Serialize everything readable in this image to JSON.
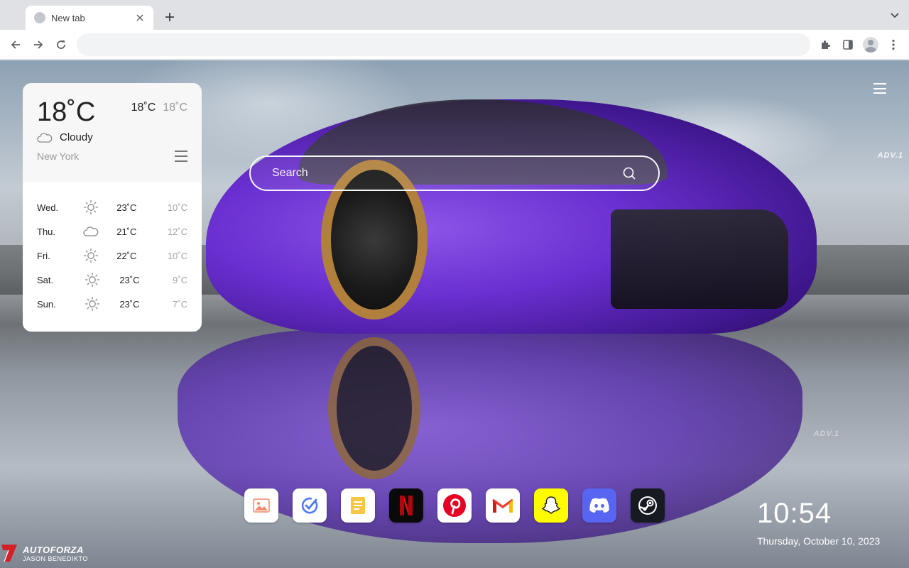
{
  "tab": {
    "title": "New tab",
    "close_icon": "close-icon",
    "new_tab_icon": "plus-icon"
  },
  "toolbar": {
    "address_value": "",
    "icons": [
      "back-arrow-icon",
      "forward-arrow-icon",
      "reload-icon",
      "extensions-icon",
      "side-panel-icon",
      "profile-avatar-icon",
      "more-vertical-icon"
    ]
  },
  "weather": {
    "temp": "18˚C",
    "high": "18˚C",
    "low": "18˚C",
    "condition": "Cloudy",
    "city": "New York",
    "forecast": [
      {
        "day": "Wed.",
        "icon": "sun-icon",
        "high": "23˚C",
        "low": "10˚C"
      },
      {
        "day": "Thu.",
        "icon": "cloud-icon",
        "high": "21˚C",
        "low": "12˚C"
      },
      {
        "day": "Fri.",
        "icon": "sun-icon",
        "high": "22˚C",
        "low": "10˚C"
      },
      {
        "day": "Sat.",
        "icon": "sun-icon",
        "high": "23˚C",
        "low": "9˚C"
      },
      {
        "day": "Sun.",
        "icon": "sun-icon",
        "high": "23˚C",
        "low": "7˚C"
      }
    ]
  },
  "search": {
    "placeholder": "Search"
  },
  "dock": {
    "apps": [
      {
        "name": "photos-icon",
        "bg": "#ffffff"
      },
      {
        "name": "tasks-check-icon",
        "bg": "#ffffff"
      },
      {
        "name": "notes-icon",
        "bg": "#ffffff"
      },
      {
        "name": "netflix-icon",
        "bg": "#0a0a0a",
        "glyph": "N"
      },
      {
        "name": "pinterest-icon",
        "bg": "#ffffff",
        "glyph": "P"
      },
      {
        "name": "gmail-icon",
        "bg": "#ffffff"
      },
      {
        "name": "snapchat-icon",
        "bg": "#fffc00"
      },
      {
        "name": "discord-icon",
        "bg": "#5865f2"
      },
      {
        "name": "steam-icon",
        "bg": "#171a21"
      }
    ]
  },
  "clock": {
    "time": "10:54",
    "date": "Thursday, October 10, 2023"
  },
  "wallpaper": {
    "watermark_top": "ADV.1",
    "watermark_reflection": "ADV.1",
    "brand_line1": "AUTOFORZA",
    "brand_line2": "JASON BENEDIKTO"
  },
  "colors": {
    "netflix_red": "#e50914",
    "pinterest_red": "#e60023",
    "discord_blurple": "#5865f2",
    "snapchat_yellow": "#fffc00"
  }
}
